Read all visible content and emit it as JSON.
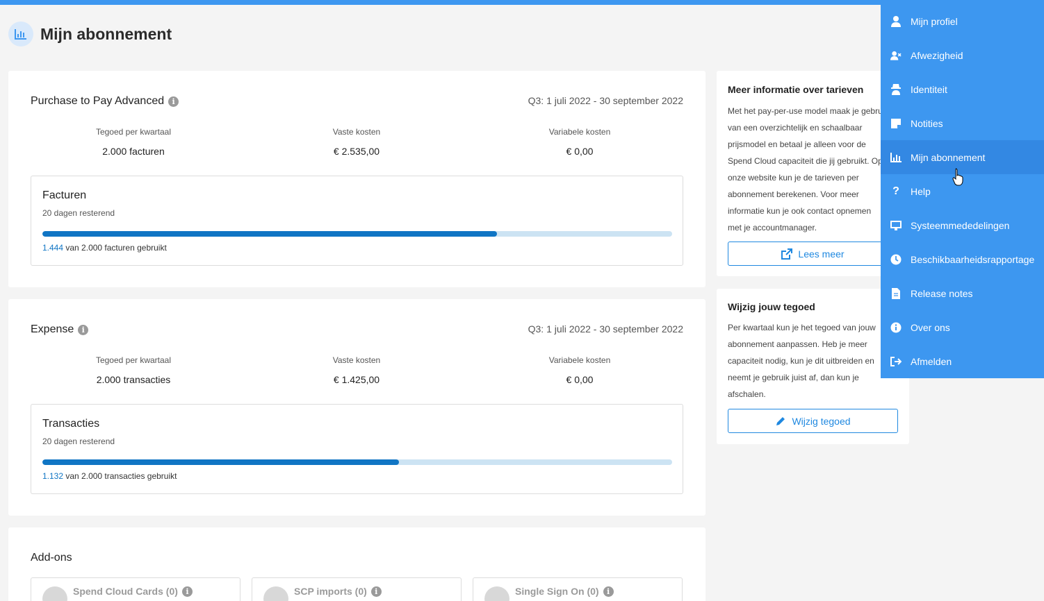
{
  "header": {
    "title": "Mijn abonnement",
    "icon": "bar-chart-icon"
  },
  "plans": [
    {
      "title": "Purchase to Pay Advanced",
      "period": "Q3: 1 juli 2022 - 30 september 2022",
      "stats": [
        {
          "label": "Tegoed per kwartaal",
          "value": "2.000 facturen"
        },
        {
          "label": "Vaste kosten",
          "value": "€ 2.535,00"
        },
        {
          "label": "Variabele kosten",
          "value": "€ 0,00"
        }
      ],
      "usage": {
        "title": "Facturen",
        "remaining": "20 dagen resterend",
        "used": "1.444",
        "total_text": "van 2.000 facturen gebruikt",
        "progress_fraction": 0.722
      }
    },
    {
      "title": "Expense",
      "period": "Q3: 1 juli 2022 - 30 september 2022",
      "stats": [
        {
          "label": "Tegoed per kwartaal",
          "value": "2.000 transacties"
        },
        {
          "label": "Vaste kosten",
          "value": "€ 1.425,00"
        },
        {
          "label": "Variabele kosten",
          "value": "€ 0,00"
        }
      ],
      "usage": {
        "title": "Transacties",
        "remaining": "20 dagen resterend",
        "used": "1.132",
        "total_text": "van 2.000 transacties gebruikt",
        "progress_fraction": 0.566
      }
    }
  ],
  "addons": {
    "title": "Add-ons",
    "items": [
      {
        "label": "Spend Cloud Cards (0)",
        "icon": "card-icon"
      },
      {
        "label": "SCP imports (0)",
        "icon": "import-icon"
      },
      {
        "label": "Single Sign On (0)",
        "icon": "user-check-icon"
      }
    ]
  },
  "info_card": {
    "title": "Meer informatie over tarieven",
    "lines": [
      "Met het pay-per-use model maak je gebruik",
      "van een overzichtelijk en schaalbaar",
      "prijsmodel en betaal je alleen voor de",
      "Spend Cloud capaciteit die jij gebruikt. Op",
      "onze website kun je de tarieven per",
      "abonnement berekenen. Voor meer",
      "informatie kun je ook contact opnemen",
      "met je accountmanager."
    ],
    "button": "Lees meer"
  },
  "credit_card": {
    "title": "Wijzig jouw tegoed",
    "lines": [
      "Per kwartaal kun je het tegoed van jouw",
      "abonnement aanpassen. Heb je meer",
      "capaciteit nodig, kun je dit uitbreiden en",
      "neemt je gebruik juist af, dan kun je",
      "afschalen."
    ],
    "button": "Wijzig tegoed"
  },
  "menu": {
    "items": [
      {
        "label": "Mijn profiel",
        "icon": "user-icon"
      },
      {
        "label": "Afwezigheid",
        "icon": "user-away-icon"
      },
      {
        "label": "Identiteit",
        "icon": "spy-icon"
      },
      {
        "label": "Notities",
        "icon": "note-icon"
      },
      {
        "label": "Mijn abonnement",
        "icon": "bar-chart-icon",
        "active": true
      },
      {
        "label": "Help",
        "icon": "question-icon"
      },
      {
        "label": "Systeemmededelingen",
        "icon": "monitor-icon"
      },
      {
        "label": "Beschikbaarheidsrapportage",
        "icon": "clock-icon"
      },
      {
        "label": "Release notes",
        "icon": "document-icon"
      },
      {
        "label": "Over ons",
        "icon": "info-icon"
      },
      {
        "label": "Afmelden",
        "icon": "logout-icon"
      }
    ]
  },
  "colors": {
    "accent": "#3d97f0",
    "progress": "#1075c4",
    "progress_track": "#cce3f3"
  }
}
